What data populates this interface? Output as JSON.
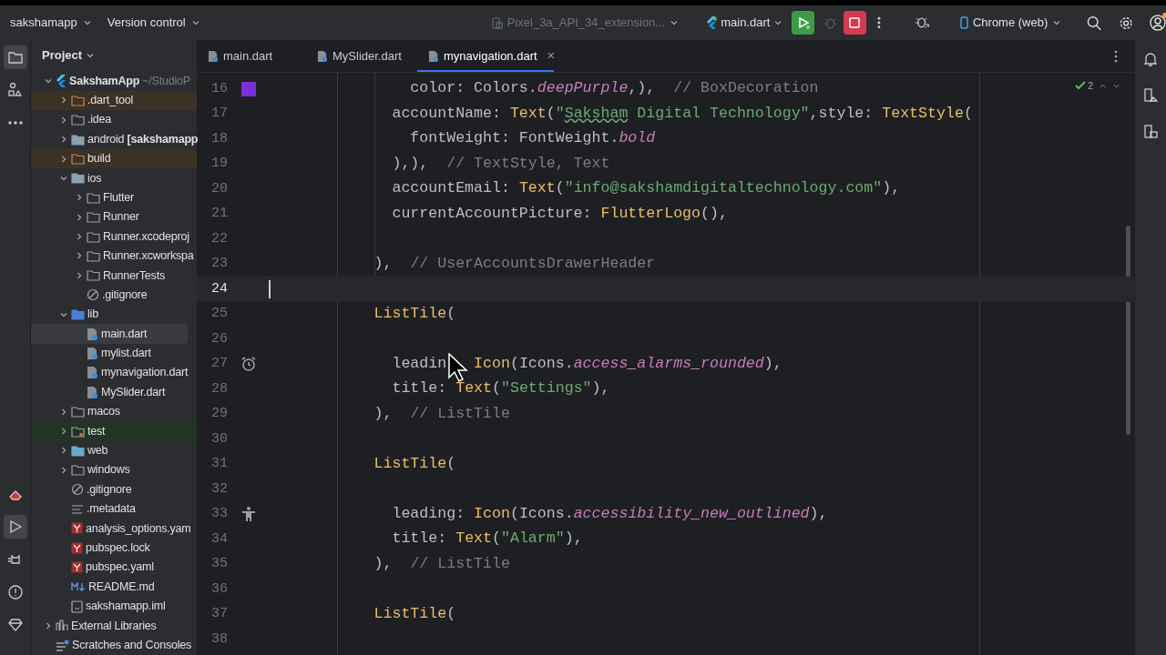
{
  "toolbar": {
    "project": "sakshamapp",
    "vcs": "Version control",
    "device": {
      "label": "Pixel_3a_API_34_extension...",
      "disabled": true
    },
    "run_config": "main.dart",
    "target": "Chrome (web)",
    "notification_dot": true
  },
  "project_panel": {
    "title": "Project",
    "tree": [
      {
        "kind": "project",
        "name": "SakshamApp",
        "path": "~/StudioP",
        "expanded": true,
        "selected": false,
        "children": [
          {
            "kind": "folder-excluded",
            "name": ".dart_tool",
            "expanded": false,
            "selected": false,
            "color": "#3d3024"
          },
          {
            "kind": "folder-config",
            "name": ".idea",
            "expanded": false,
            "selected": false
          },
          {
            "kind": "folder-module",
            "name": "android **[sakshamapp**",
            "expanded": false,
            "selected": false
          },
          {
            "kind": "folder-excluded",
            "name": "build",
            "expanded": false,
            "selected": false,
            "color": "#3d3024"
          },
          {
            "kind": "folder-module",
            "name": "ios",
            "expanded": true,
            "selected": false,
            "children": [
              {
                "kind": "folder",
                "name": "Flutter",
                "expanded": false,
                "selected": false
              },
              {
                "kind": "folder",
                "name": "Runner",
                "expanded": false,
                "selected": false
              },
              {
                "kind": "folder",
                "name": "Runner.xcodeproj",
                "expanded": false,
                "selected": false
              },
              {
                "kind": "folder",
                "name": "Runner.xcworkspa",
                "expanded": false,
                "selected": false
              },
              {
                "kind": "folder",
                "name": "RunnerTests",
                "expanded": false,
                "selected": false
              },
              {
                "kind": "ignore",
                "name": ".gitignore",
                "selected": false
              }
            ]
          },
          {
            "kind": "folder-source",
            "name": "lib",
            "expanded": true,
            "selected": false,
            "children": [
              {
                "kind": "dart",
                "name": "main.dart",
                "selected": true
              },
              {
                "kind": "dart",
                "name": "mylist.dart",
                "selected": false
              },
              {
                "kind": "dart",
                "name": "mynavigation.dart",
                "selected": false
              },
              {
                "kind": "dart",
                "name": "MySlider.dart",
                "selected": false
              }
            ]
          },
          {
            "kind": "folder",
            "name": "macos",
            "expanded": false,
            "selected": false
          },
          {
            "kind": "folder-test",
            "name": "test",
            "expanded": false,
            "selected": false,
            "color": "#233424"
          },
          {
            "kind": "folder-web",
            "name": "web",
            "expanded": false,
            "selected": false
          },
          {
            "kind": "folder",
            "name": "windows",
            "expanded": false,
            "selected": false
          },
          {
            "kind": "ignore",
            "name": ".gitignore",
            "selected": false
          },
          {
            "kind": "lines",
            "name": ".metadata",
            "selected": false
          },
          {
            "kind": "yaml",
            "name": "analysis_options.yam",
            "selected": false
          },
          {
            "kind": "yaml",
            "name": "pubspec.lock",
            "selected": false
          },
          {
            "kind": "yaml",
            "name": "pubspec.yaml",
            "selected": false
          },
          {
            "kind": "md",
            "name": "README.md",
            "selected": false
          },
          {
            "kind": "iml",
            "name": "sakshamapp.iml",
            "selected": false
          }
        ]
      },
      {
        "kind": "libraries",
        "name": "External Libraries",
        "expanded": false,
        "selected": false
      },
      {
        "kind": "scratches",
        "name": "Scratches and Consoles",
        "selected": false
      }
    ]
  },
  "tabs": [
    {
      "label": "main.dart",
      "selected": false
    },
    {
      "label": "MySlider.dart",
      "selected": false
    },
    {
      "label": "mynavigation.dart",
      "selected": true,
      "close": "×"
    }
  ],
  "inspections": {
    "count": "2"
  },
  "code": [
    {
      "n": "16",
      "current": false,
      "gutter": {
        "kind": "swatch",
        "color": "#7c2fd9"
      },
      "tokens": [
        {
          "text": "               color: Colors.",
          "kind": "plain"
        },
        {
          "text": "deepPurple",
          "kind": "constant"
        },
        {
          "text": ",),  ",
          "kind": "plain"
        },
        {
          "text": "// BoxDecoration",
          "kind": "comment"
        }
      ]
    },
    {
      "n": "17",
      "current": false,
      "tokens": [
        {
          "text": "             accountName: ",
          "kind": "plain"
        },
        {
          "text": "Text",
          "kind": "class"
        },
        {
          "text": "(",
          "kind": "plain"
        },
        {
          "text": "\"",
          "kind": "string"
        },
        {
          "text": "Saksham",
          "kind": "typo"
        },
        {
          "text": " Digital Technology\"",
          "kind": "string"
        },
        {
          "text": ",style: ",
          "kind": "plain"
        },
        {
          "text": "TextStyle",
          "kind": "class"
        },
        {
          "text": "(",
          "kind": "plain"
        }
      ]
    },
    {
      "n": "18",
      "current": false,
      "tokens": [
        {
          "text": "               fontWeight: FontWeight.",
          "kind": "plain"
        },
        {
          "text": "bold",
          "kind": "constant"
        }
      ]
    },
    {
      "n": "19",
      "current": false,
      "tokens": [
        {
          "text": "             ),),  ",
          "kind": "plain"
        },
        {
          "text": "// TextStyle, Text",
          "kind": "comment"
        }
      ]
    },
    {
      "n": "20",
      "current": false,
      "tokens": [
        {
          "text": "             accountEmail: ",
          "kind": "plain"
        },
        {
          "text": "Text",
          "kind": "class"
        },
        {
          "text": "(",
          "kind": "plain"
        },
        {
          "text": "\"info@sakshamdigitaltechnology.com\"",
          "kind": "string"
        },
        {
          "text": "),",
          "kind": "plain"
        }
      ]
    },
    {
      "n": "21",
      "current": false,
      "tokens": [
        {
          "text": "             currentAccountPicture: ",
          "kind": "plain"
        },
        {
          "text": "FlutterLogo",
          "kind": "class"
        },
        {
          "text": "(),",
          "kind": "plain"
        }
      ]
    },
    {
      "n": "22",
      "current": false
    },
    {
      "n": "23",
      "current": false,
      "tokens": [
        {
          "text": "           ),  ",
          "kind": "plain"
        },
        {
          "text": "// UserAccountsDrawerHeader",
          "kind": "comment"
        }
      ]
    },
    {
      "n": "24",
      "current": true
    },
    {
      "n": "25",
      "current": false,
      "tokens": [
        {
          "text": "           ListTile",
          "kind": "class"
        },
        {
          "text": "(",
          "kind": "plain"
        }
      ]
    },
    {
      "n": "26",
      "current": false
    },
    {
      "n": "27",
      "current": false,
      "gutter": {
        "kind": "alarm"
      },
      "tokens": [
        {
          "text": "             leadin",
          "kind": "plain"
        },
        {
          "text": "   Icon",
          "kind": "class"
        },
        {
          "text": "(Icons.",
          "kind": "plain"
        },
        {
          "text": "access_alarms_rounded",
          "kind": "constant"
        },
        {
          "text": "),",
          "kind": "plain"
        }
      ]
    },
    {
      "n": "28",
      "current": false,
      "tokens": [
        {
          "text": "             title: ",
          "kind": "plain"
        },
        {
          "text": "Text",
          "kind": "class"
        },
        {
          "text": "(",
          "kind": "plain"
        },
        {
          "text": "\"Settings\"",
          "kind": "string"
        },
        {
          "text": "),",
          "kind": "plain"
        }
      ]
    },
    {
      "n": "29",
      "current": false,
      "tokens": [
        {
          "text": "           ),  ",
          "kind": "plain"
        },
        {
          "text": "// ListTile",
          "kind": "comment"
        }
      ]
    },
    {
      "n": "30",
      "current": false
    },
    {
      "n": "31",
      "current": false,
      "tokens": [
        {
          "text": "           ListTile",
          "kind": "class"
        },
        {
          "text": "(",
          "kind": "plain"
        }
      ]
    },
    {
      "n": "32",
      "current": false
    },
    {
      "n": "33",
      "current": false,
      "gutter": {
        "kind": "person"
      },
      "tokens": [
        {
          "text": "             leading: ",
          "kind": "plain"
        },
        {
          "text": "Icon",
          "kind": "class"
        },
        {
          "text": "(Icons.",
          "kind": "plain"
        },
        {
          "text": "accessibility_new_outlined",
          "kind": "constant"
        },
        {
          "text": "),",
          "kind": "plain"
        }
      ]
    },
    {
      "n": "34",
      "current": false,
      "tokens": [
        {
          "text": "             title: ",
          "kind": "plain"
        },
        {
          "text": "Text",
          "kind": "class"
        },
        {
          "text": "(",
          "kind": "plain"
        },
        {
          "text": "\"Alarm\"",
          "kind": "string"
        },
        {
          "text": "),",
          "kind": "plain"
        }
      ]
    },
    {
      "n": "35",
      "current": false,
      "tokens": [
        {
          "text": "           ),  ",
          "kind": "plain"
        },
        {
          "text": "// ListTile",
          "kind": "comment"
        }
      ]
    },
    {
      "n": "36",
      "current": false
    },
    {
      "n": "37",
      "current": false,
      "tokens": [
        {
          "text": "           ListTile",
          "kind": "class"
        },
        {
          "text": "(",
          "kind": "plain"
        }
      ]
    },
    {
      "n": "38",
      "current": false
    }
  ]
}
